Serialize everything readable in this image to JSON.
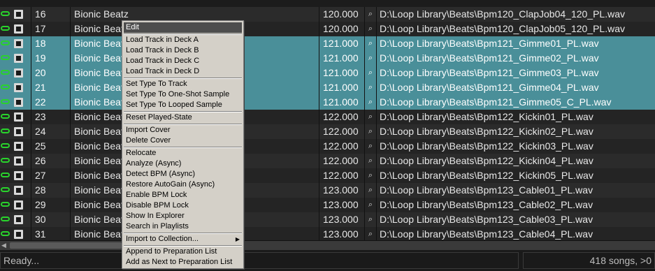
{
  "tracks": [
    {
      "num": "16",
      "artist": "Bionic Beatz",
      "bpm": "120.000",
      "path": "D:\\Loop Library\\Beats\\Bpm120_ClapJob04_120_PL.wav",
      "selected": false
    },
    {
      "num": "17",
      "artist": "Bionic Beatz",
      "bpm": "120.000",
      "path": "D:\\Loop Library\\Beats\\Bpm120_ClapJob05_120_PL.wav",
      "selected": false
    },
    {
      "num": "18",
      "artist": "Bionic Beatz",
      "bpm": "121.000",
      "path": "D:\\Loop Library\\Beats\\Bpm121_Gimme01_PL.wav",
      "selected": true
    },
    {
      "num": "19",
      "artist": "Bionic Beatz",
      "bpm": "121.000",
      "path": "D:\\Loop Library\\Beats\\Bpm121_Gimme02_PL.wav",
      "selected": true
    },
    {
      "num": "20",
      "artist": "Bionic Beatz",
      "bpm": "121.000",
      "path": "D:\\Loop Library\\Beats\\Bpm121_Gimme03_PL.wav",
      "selected": true
    },
    {
      "num": "21",
      "artist": "Bionic Beatz",
      "bpm": "121.000",
      "path": "D:\\Loop Library\\Beats\\Bpm121_Gimme04_PL.wav",
      "selected": true
    },
    {
      "num": "22",
      "artist": "Bionic Beatz",
      "bpm": "121.000",
      "path": "D:\\Loop Library\\Beats\\Bpm121_Gimme05_C_PL.wav",
      "selected": true
    },
    {
      "num": "23",
      "artist": "Bionic Beatz",
      "bpm": "122.000",
      "path": "D:\\Loop Library\\Beats\\Bpm122_Kickin01_PL.wav",
      "selected": false
    },
    {
      "num": "24",
      "artist": "Bionic Beatz",
      "bpm": "122.000",
      "path": "D:\\Loop Library\\Beats\\Bpm122_Kickin02_PL.wav",
      "selected": false
    },
    {
      "num": "25",
      "artist": "Bionic Beatz",
      "bpm": "122.000",
      "path": "D:\\Loop Library\\Beats\\Bpm122_Kickin03_PL.wav",
      "selected": false
    },
    {
      "num": "26",
      "artist": "Bionic Beatz",
      "bpm": "122.000",
      "path": "D:\\Loop Library\\Beats\\Bpm122_Kickin04_PL.wav",
      "selected": false
    },
    {
      "num": "27",
      "artist": "Bionic Beatz",
      "bpm": "122.000",
      "path": "D:\\Loop Library\\Beats\\Bpm122_Kickin05_PL.wav",
      "selected": false
    },
    {
      "num": "28",
      "artist": "Bionic Beatz",
      "bpm": "123.000",
      "path": "D:\\Loop Library\\Beats\\Bpm123_Cable01_PL.wav",
      "selected": false
    },
    {
      "num": "29",
      "artist": "Bionic Beatz",
      "bpm": "123.000",
      "path": "D:\\Loop Library\\Beats\\Bpm123_Cable02_PL.wav",
      "selected": false
    },
    {
      "num": "30",
      "artist": "Bionic Beatz",
      "bpm": "123.000",
      "path": "D:\\Loop Library\\Beats\\Bpm123_Cable03_PL.wav",
      "selected": false
    },
    {
      "num": "31",
      "artist": "Bionic Beatz",
      "bpm": "123.000",
      "path": "D:\\Loop Library\\Beats\\Bpm123_Cable04_PL.wav",
      "selected": false
    }
  ],
  "context_menu": {
    "items": [
      {
        "label": "Edit",
        "highlighted": true
      },
      {
        "sep": true
      },
      {
        "label": "Load Track in Deck A"
      },
      {
        "label": "Load Track in Deck B"
      },
      {
        "label": "Load Track in Deck C"
      },
      {
        "label": "Load Track in Deck D"
      },
      {
        "sep": true
      },
      {
        "label": "Set Type To Track"
      },
      {
        "label": "Set Type To One-Shot Sample"
      },
      {
        "label": "Set Type To Looped Sample"
      },
      {
        "sep": true
      },
      {
        "label": "Reset Played-State"
      },
      {
        "sep": true
      },
      {
        "label": "Import Cover"
      },
      {
        "label": "Delete Cover"
      },
      {
        "sep": true
      },
      {
        "label": "Relocate"
      },
      {
        "label": "Analyze (Async)"
      },
      {
        "label": "Detect BPM (Async)"
      },
      {
        "label": "Restore AutoGain (Async)"
      },
      {
        "label": "Enable BPM Lock"
      },
      {
        "label": "Disable BPM Lock"
      },
      {
        "label": "Show In Explorer"
      },
      {
        "label": "Search in Playlists"
      },
      {
        "sep": true
      },
      {
        "label": "Import to Collection...",
        "submenu": true
      },
      {
        "sep": true
      },
      {
        "label": "Append to Preparation List"
      },
      {
        "label": "Add as Next to Preparation List"
      }
    ]
  },
  "status": {
    "left": "Ready...",
    "right": "418 songs, >0"
  },
  "icons": {
    "loop": "loop-icon",
    "deck": "deck-icon",
    "search": "magnifier-icon",
    "scroll_left": "scroll-left-arrow-icon",
    "submenu": "submenu-arrow-icon"
  },
  "colors": {
    "selection": "#4a8f99",
    "loop_icon": "#29d32c",
    "menu_bg": "#d4d0c8",
    "menu_highlight": "#4d4d4d"
  }
}
